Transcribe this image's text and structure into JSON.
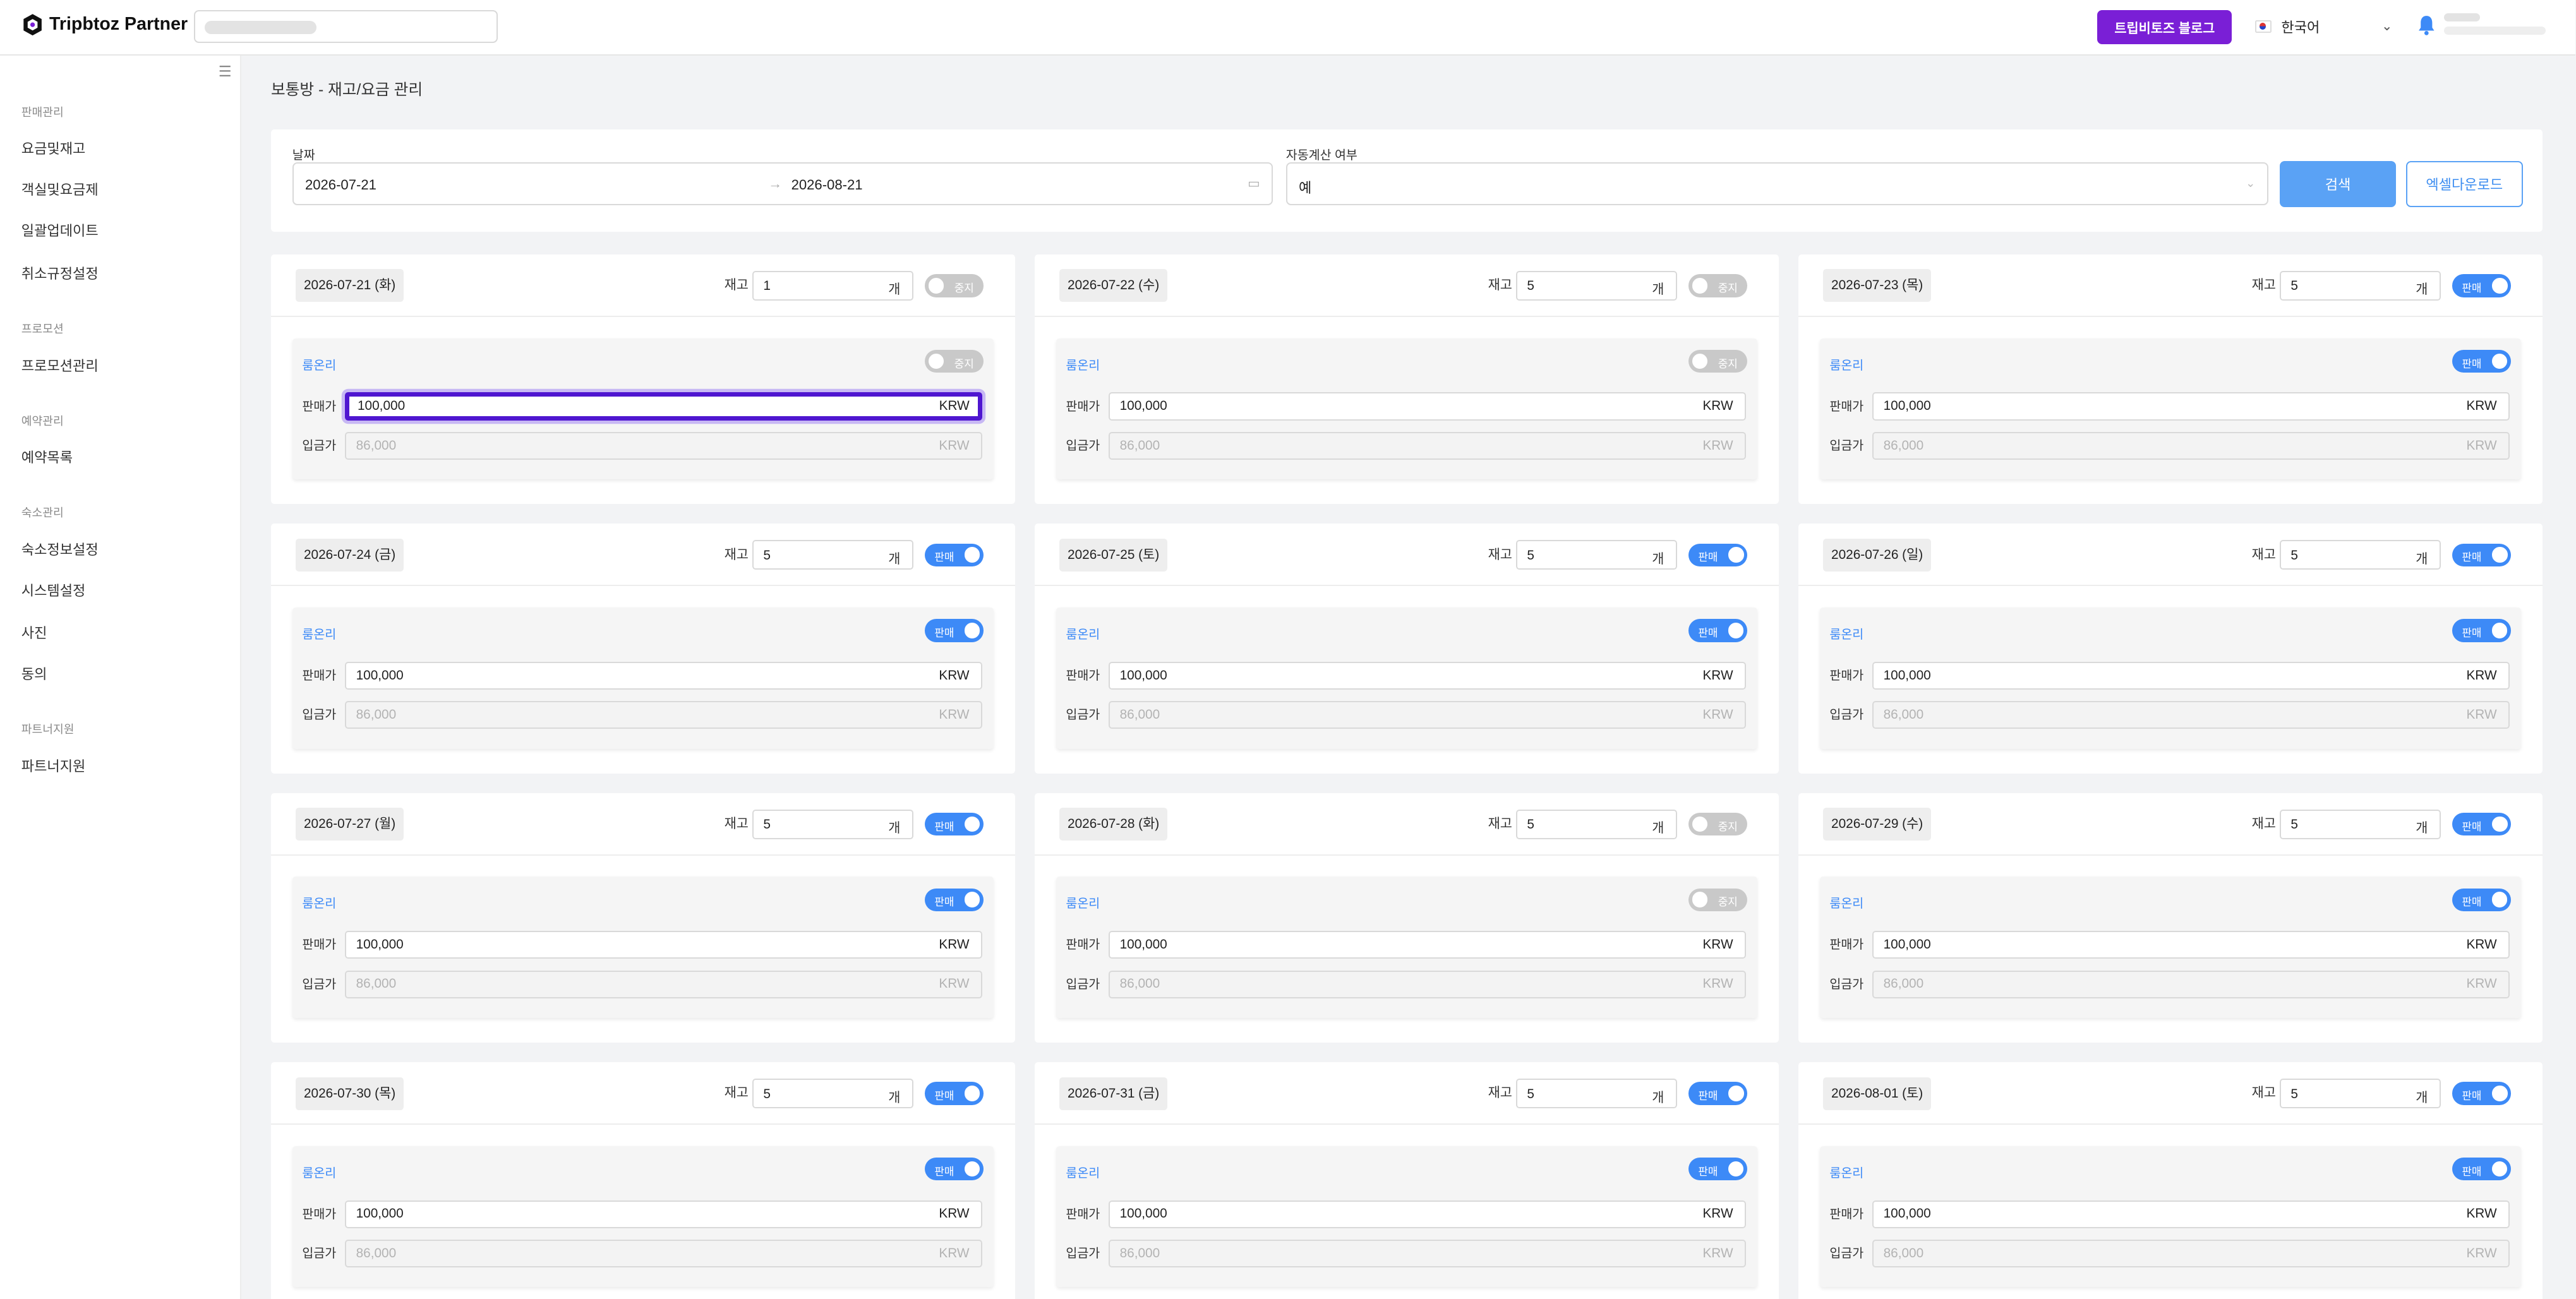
{
  "header": {
    "logo_text": "Tripbtoz Partner",
    "blog_button": "트립비토즈 블로그",
    "language": "한국어",
    "brand_color": "#7a1fd6"
  },
  "sidebar": {
    "groups": [
      {
        "title": "판매관리",
        "items": [
          "요금및재고",
          "객실및요금제",
          "일괄업데이트",
          "취소규정설정"
        ]
      },
      {
        "title": "프로모션",
        "items": [
          "프로모션관리"
        ]
      },
      {
        "title": "예약관리",
        "items": [
          "예약목록"
        ]
      },
      {
        "title": "숙소관리",
        "items": [
          "숙소정보설정",
          "시스템설정",
          "사진",
          "동의"
        ]
      },
      {
        "title": "파트너지원",
        "items": [
          "파트너지원"
        ]
      }
    ]
  },
  "breadcrumb": "보통방 - 재고/요금 관리",
  "filter": {
    "date_label": "날짜",
    "start_date": "2026-07-21",
    "end_date": "2026-08-21",
    "auto_calc_label": "자동계산 여부",
    "auto_calc_value": "예",
    "search_button": "검색",
    "excel_button": "엑셀다운로드"
  },
  "labels": {
    "stock": "재고",
    "unit": "개",
    "room_name": "룸온리",
    "sale_price": "판매가",
    "deposit_price": "입금가",
    "currency": "KRW",
    "on": "판매",
    "off": "중지"
  },
  "cards": [
    {
      "date": "2026-07-21 (화)",
      "stock": "1",
      "date_on": false,
      "room_on": false,
      "sale": "100,000",
      "deposit": "86,000"
    },
    {
      "date": "2026-07-22 (수)",
      "stock": "5",
      "date_on": false,
      "room_on": false,
      "sale": "100,000",
      "deposit": "86,000"
    },
    {
      "date": "2026-07-23 (목)",
      "stock": "5",
      "date_on": true,
      "room_on": true,
      "sale": "100,000",
      "deposit": "86,000"
    },
    {
      "date": "2026-07-24 (금)",
      "stock": "5",
      "date_on": true,
      "room_on": true,
      "sale": "100,000",
      "deposit": "86,000"
    },
    {
      "date": "2026-07-25 (토)",
      "stock": "5",
      "date_on": true,
      "room_on": true,
      "sale": "100,000",
      "deposit": "86,000"
    },
    {
      "date": "2026-07-26 (일)",
      "stock": "5",
      "date_on": true,
      "room_on": true,
      "sale": "100,000",
      "deposit": "86,000"
    },
    {
      "date": "2026-07-27 (월)",
      "stock": "5",
      "date_on": true,
      "room_on": true,
      "sale": "100,000",
      "deposit": "86,000"
    },
    {
      "date": "2026-07-28 (화)",
      "stock": "5",
      "date_on": false,
      "room_on": false,
      "sale": "100,000",
      "deposit": "86,000"
    },
    {
      "date": "2026-07-29 (수)",
      "stock": "5",
      "date_on": true,
      "room_on": true,
      "sale": "100,000",
      "deposit": "86,000"
    },
    {
      "date": "2026-07-30 (목)",
      "stock": "5",
      "date_on": true,
      "room_on": true,
      "sale": "100,000",
      "deposit": "86,000"
    },
    {
      "date": "2026-07-31 (금)",
      "stock": "5",
      "date_on": true,
      "room_on": true,
      "sale": "100,000",
      "deposit": "86,000"
    },
    {
      "date": "2026-08-01 (토)",
      "stock": "5",
      "date_on": true,
      "room_on": true,
      "sale": "100,000",
      "deposit": "86,000"
    }
  ],
  "colors": {
    "toggle_on": "#3d8af7",
    "toggle_off": "#c9c9c9",
    "focus_border": "#4f16d0",
    "search_button": "#5aa2f5"
  }
}
